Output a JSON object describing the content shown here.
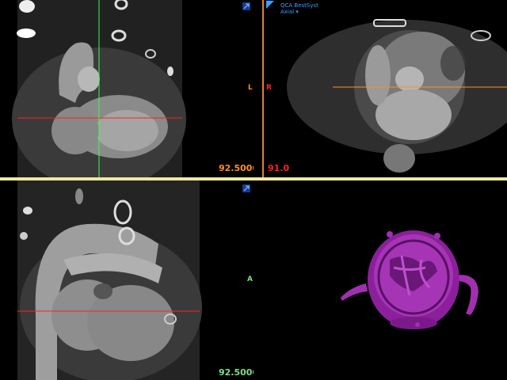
{
  "views": {
    "top_left": {
      "value": "92.5000",
      "value_color": "#ff8c2a"
    },
    "top_right": {
      "value": "91.0",
      "value_color": "#ff2020",
      "series_line1": "QCA BestSyst",
      "series_line2": "Axial ▾",
      "orient_left": "L",
      "orient_right": "R"
    },
    "bottom_left": {
      "value": "92.5000",
      "value_color": "#7fe07f",
      "orient": "A"
    },
    "bottom_right": {}
  },
  "colors": {
    "separator_h": "#f0e8a0",
    "separator_v": "#e08040",
    "crosshair_red": "#ff2020",
    "crosshair_green": "#40ff40",
    "crosshair_orange": "#ff8c2a",
    "render_3d": "#a030b0"
  }
}
